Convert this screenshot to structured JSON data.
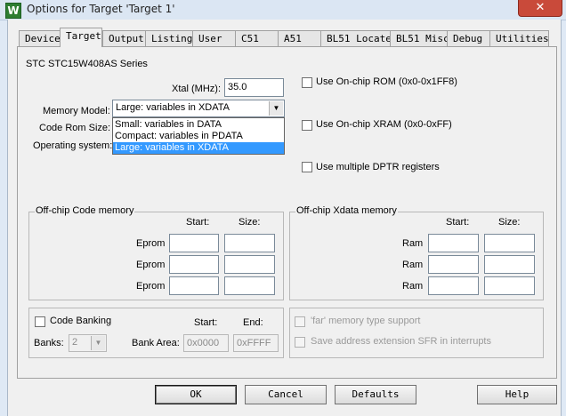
{
  "window": {
    "title": "Options for Target 'Target 1'",
    "app_icon_glyph": "W",
    "close_glyph": "✕"
  },
  "tabs": [
    "Device",
    "Target",
    "Output",
    "Listing",
    "User",
    "C51",
    "A51",
    "BL51 Locate",
    "BL51 Misc",
    "Debug",
    "Utilities"
  ],
  "active_tab": "Target",
  "device_name": "STC STC15W408AS Series",
  "xtal": {
    "label": "Xtal (MHz):",
    "value": "35.0"
  },
  "memory_model": {
    "label": "Memory Model:",
    "selected": "Large: variables in XDATA",
    "options": [
      "Small: variables in DATA",
      "Compact: variables in PDATA",
      "Large: variables in XDATA"
    ],
    "highlighted_index": 2
  },
  "code_rom_size": {
    "label": "Code Rom Size:"
  },
  "operating_system": {
    "label": "Operating system:"
  },
  "checkboxes": {
    "onchip_rom": {
      "label": "Use On-chip ROM (0x0-0x1FF8)",
      "checked": false
    },
    "onchip_xram": {
      "label": "Use On-chip XRAM (0x0-0xFF)",
      "checked": false
    },
    "multiple_dptr": {
      "label": "Use multiple DPTR registers",
      "checked": false
    }
  },
  "offchip_code": {
    "title": "Off-chip Code memory",
    "start_header": "Start:",
    "size_header": "Size:",
    "rows": [
      {
        "label": "Eprom"
      },
      {
        "label": "Eprom"
      },
      {
        "label": "Eprom"
      }
    ]
  },
  "offchip_xdata": {
    "title": "Off-chip Xdata memory",
    "start_header": "Start:",
    "size_header": "Size:",
    "rows": [
      {
        "label": "Ram"
      },
      {
        "label": "Ram"
      },
      {
        "label": "Ram"
      }
    ]
  },
  "code_banking": {
    "label": "Code Banking",
    "checked": false,
    "start_header": "Start:",
    "end_header": "End:",
    "banks_label": "Banks:",
    "banks_value": "2",
    "bank_area_label": "Bank Area:",
    "bank_area_start": "0x0000",
    "bank_area_end": "0xFFFF"
  },
  "far_memory": {
    "label": "'far' memory type support",
    "checked": false
  },
  "save_sfr": {
    "label": "Save address extension SFR in interrupts",
    "checked": false
  },
  "buttons": {
    "ok": "OK",
    "cancel": "Cancel",
    "defaults": "Defaults",
    "help": "Help"
  }
}
